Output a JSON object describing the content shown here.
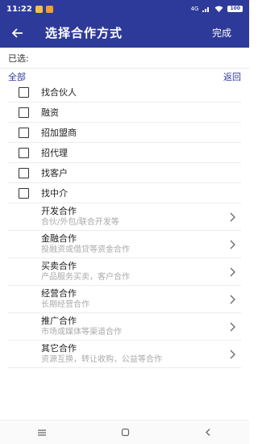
{
  "status": {
    "time": "11:22",
    "battery": "100",
    "signal_text": "4G"
  },
  "header": {
    "title": "选择合作方式",
    "done_label": "完成"
  },
  "selected_label": "已选:",
  "nav": {
    "all_label": "全部",
    "back_label": "返回"
  },
  "options": [
    {
      "label": "找合伙人"
    },
    {
      "label": "融资"
    },
    {
      "label": "招加盟商"
    },
    {
      "label": "招代理"
    },
    {
      "label": "找客户"
    },
    {
      "label": "找中介"
    }
  ],
  "categories": [
    {
      "title": "开发合作",
      "subtitle": "合伙/外包/联合开发等"
    },
    {
      "title": "金融合作",
      "subtitle": "投融资或借贷等资金合作"
    },
    {
      "title": "买卖合作",
      "subtitle": "产品服务买卖，客户合作"
    },
    {
      "title": "经营合作",
      "subtitle": "长期经营合作"
    },
    {
      "title": "推广合作",
      "subtitle": "市场或媒体等渠道合作"
    },
    {
      "title": "其它合作",
      "subtitle": "资源互换，转让收购，公益等合作"
    }
  ],
  "colors": {
    "primary": "#2e3a9a",
    "app_icon_1": "#f5c04a",
    "app_icon_2": "#f0a030"
  },
  "icons": {
    "back": "arrow-left-icon",
    "chevron": "chevron-right-icon",
    "nav_menu": "menu-icon",
    "nav_home": "home-icon",
    "nav_back": "back-triangle-icon"
  }
}
